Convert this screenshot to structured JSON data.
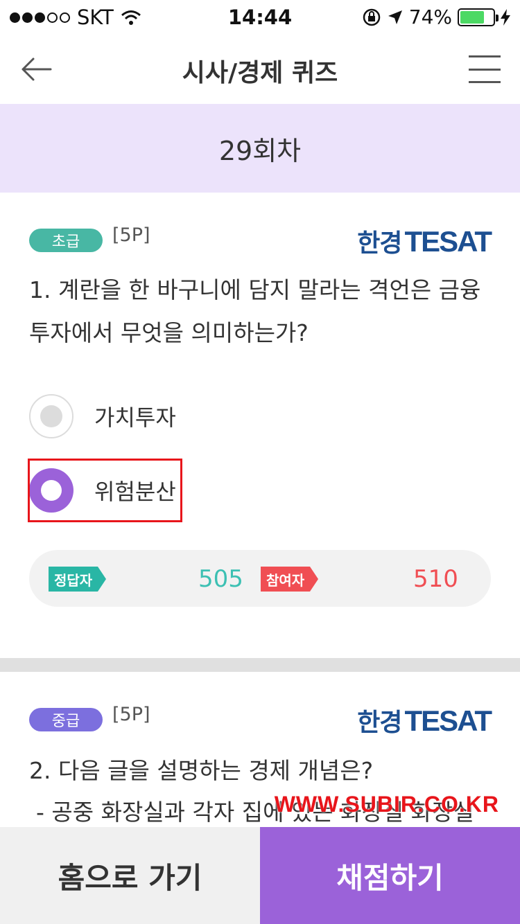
{
  "status_bar": {
    "carrier": "SKT",
    "time": "14:44",
    "battery": "74%",
    "battery_level": 0.74
  },
  "nav": {
    "title": "시사/경제 퀴즈"
  },
  "round": {
    "label": "29회차"
  },
  "question1": {
    "level": "초급",
    "points": "[5P]",
    "brand_ko": "한경",
    "brand_en": "TESAT",
    "text": "1. 계란을 한 바구니에 담지 말라는 격언은 금융 투자에서 무엇을 의미하는가?",
    "options": [
      {
        "label": "가치투자",
        "selected": false
      },
      {
        "label": "위험분산",
        "selected": true
      }
    ],
    "stats": {
      "correct_label": "정답자",
      "correct_count": "505",
      "participant_label": "참여자",
      "participant_count": "510"
    }
  },
  "question2": {
    "level": "중급",
    "points": "[5P]",
    "brand_ko": "한경",
    "brand_en": "TESAT",
    "text": "2. 다음 글을 설명하는 경제 개념은?",
    "desc": "- 공중 화장실과 각자 집에 있는 화장실 화장실"
  },
  "watermark": "WWW.SUBIR.CO.KR",
  "bottom": {
    "home_label": "홈으로 가기",
    "grade_label": "채점하기"
  },
  "colors": {
    "accent": "#9b62d9",
    "banner_bg": "#ece3fb",
    "easy_badge": "#48b7a4",
    "mid_badge": "#7c6fde",
    "correct": "#29b6a5",
    "participant": "#f04e53",
    "brand": "#1d4f91"
  }
}
